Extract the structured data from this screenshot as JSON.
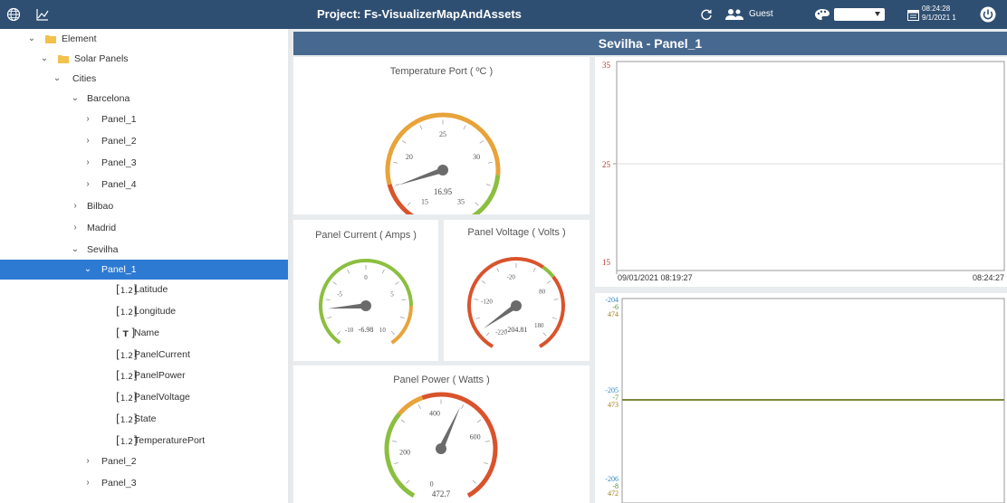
{
  "topbar": {
    "project_title": "Project: Fs-VisualizerMapAndAssets",
    "user_label": "Guest",
    "theme_value": "",
    "time": "08:24:28",
    "date": "9/1/2021 1"
  },
  "tree": {
    "root": "Element",
    "group": "Solar Panels",
    "cities_label": "Cities",
    "barcelona": {
      "label": "Barcelona",
      "panels": [
        "Panel_1",
        "Panel_2",
        "Panel_3",
        "Panel_4"
      ]
    },
    "bilbao": "Bilbao",
    "madrid": "Madrid",
    "sevilha": {
      "label": "Sevilha",
      "selected_panel": "Panel_1",
      "attributes": [
        {
          "type": "1.2",
          "name": "Latitude"
        },
        {
          "type": "1.2",
          "name": "Longitude"
        },
        {
          "type": "T",
          "name": "Name"
        },
        {
          "type": "1.2",
          "name": "PanelCurrent"
        },
        {
          "type": "1.2",
          "name": "PanelPower"
        },
        {
          "type": "1.2",
          "name": "PanelVoltage"
        },
        {
          "type": "1.2",
          "name": "State"
        },
        {
          "type": "1.2",
          "name": "TemperaturePort"
        }
      ],
      "other_panels": [
        "Panel_2",
        "Panel_3"
      ]
    }
  },
  "dashboard": {
    "header": "Sevilha - Panel_1",
    "gauges": {
      "temperature": {
        "title": "Temperature Port ( ºC )",
        "ticks": [
          "15",
          "20",
          "25",
          "30",
          "35"
        ],
        "value": 16.95,
        "value_label": "16.95"
      },
      "current": {
        "title": "Panel Current ( Amps )",
        "ticks": [
          "-10",
          "-5",
          "0",
          "5",
          "10"
        ],
        "value": -6.98,
        "value_label": "-6.98"
      },
      "voltage": {
        "title": "Panel Voltage ( Volts )",
        "ticks": [
          "-220",
          "-120",
          "-20",
          "80",
          "180"
        ],
        "value": -204.81,
        "value_label": "-204.81"
      },
      "power": {
        "title": "Panel Power ( Watts )",
        "ticks": [
          "0",
          "200",
          "400",
          "600"
        ],
        "value": 472.7,
        "value_label": "472.7"
      }
    },
    "trend1": {
      "y_top": "35",
      "y_mid": "25",
      "y_bottom": "15",
      "x_start": "09/01/2021 08:19:27",
      "x_end": "08:24:27"
    },
    "trend2": {
      "top": [
        "-204",
        "-6",
        "474"
      ],
      "mid": [
        "-205",
        "-7",
        "473"
      ],
      "bottom": [
        "-206",
        "-8",
        "472"
      ],
      "colors": [
        "#2e86c1",
        "#4a8a2a",
        "#a07c1c"
      ]
    }
  }
}
